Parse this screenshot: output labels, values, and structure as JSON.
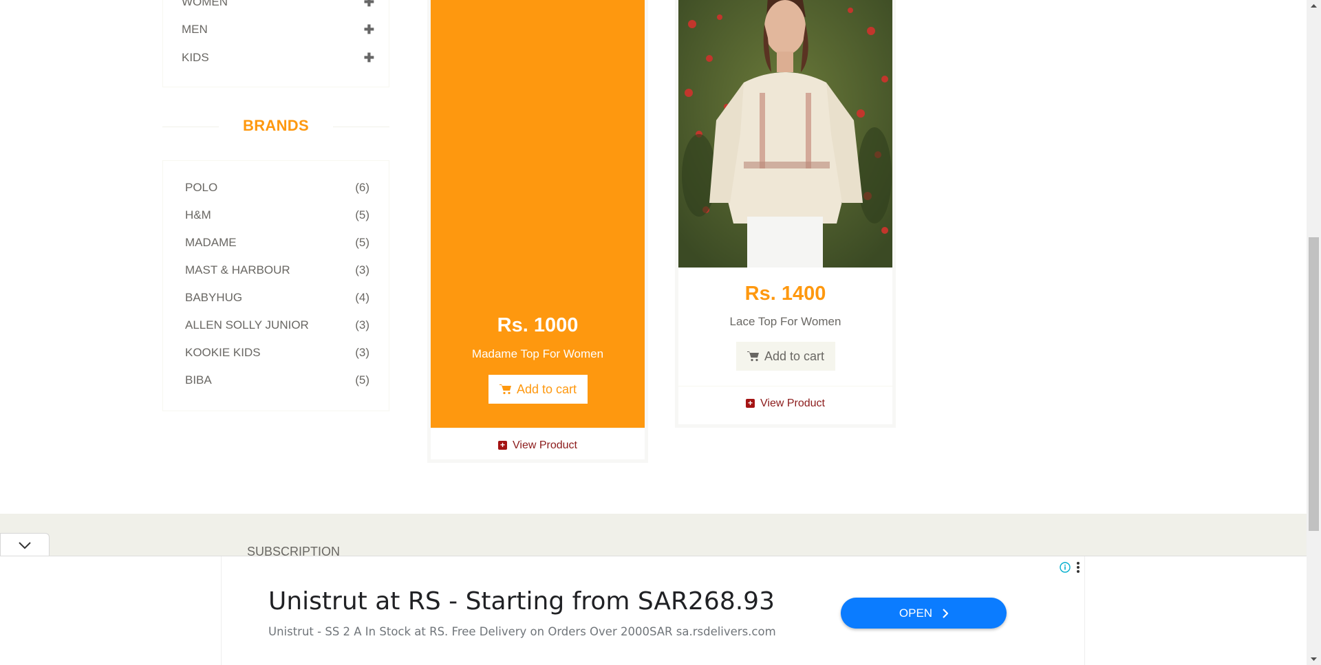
{
  "categories": [
    {
      "label": "WOMEN"
    },
    {
      "label": "MEN"
    },
    {
      "label": "KIDS"
    }
  ],
  "brands_title": "BRANDS",
  "brands": [
    {
      "name": "POLO",
      "count": "(6)"
    },
    {
      "name": "H&M",
      "count": "(5)"
    },
    {
      "name": "MADAME",
      "count": "(5)"
    },
    {
      "name": "MAST & HARBOUR",
      "count": "(3)"
    },
    {
      "name": "BABYHUG",
      "count": "(4)"
    },
    {
      "name": "ALLEN SOLLY JUNIOR",
      "count": "(3)"
    },
    {
      "name": "KOOKIE KIDS",
      "count": "(3)"
    },
    {
      "name": "BIBA",
      "count": "(5)"
    }
  ],
  "products": [
    {
      "price": "Rs. 1000",
      "name": "Madame Top For Women",
      "add_label": "Add to cart",
      "view_label": "View Product"
    },
    {
      "price": "Rs. 1400",
      "name": "Lace Top For Women",
      "add_label": "Add to cart",
      "view_label": "View Product"
    }
  ],
  "footer": {
    "subscription_label": "SUBSCRIPTION"
  },
  "ad": {
    "title": "Unistrut at RS - Starting from SAR268.93",
    "description": "Unistrut - SS 2 A In Stock at RS. Free Delivery on Orders Over 2000SAR sa.rsdelivers.com",
    "button_label": "OPEN"
  },
  "colors": {
    "accent": "#fe980f",
    "view_link": "#8b1a1a",
    "ad_button": "#0b7cff"
  },
  "icons": [
    "plus-icon",
    "shopping-cart-icon",
    "plus-square-icon",
    "chevron-down-icon",
    "info-icon",
    "more-vertical-icon",
    "chevron-right-icon"
  ]
}
